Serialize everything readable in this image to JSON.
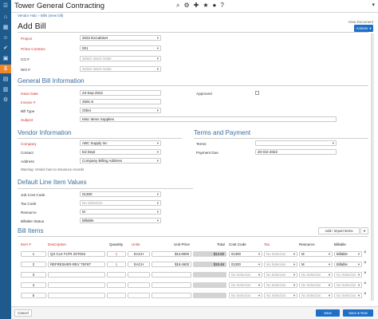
{
  "app": {
    "title": "Tower General Contracting",
    "user": "▾"
  },
  "breadcrumbs": [
    "Vendor Hub",
    "Bills (view bill)"
  ],
  "page": {
    "title": "Add Bill",
    "view_document": "View Document",
    "actions_label": "Actions"
  },
  "top_fields": [
    {
      "label": "Project",
      "value": "2022 ExCabinet",
      "required": true,
      "placeholder": false
    },
    {
      "label": "Prime Contract",
      "value": "001",
      "required": true,
      "placeholder": false
    },
    {
      "label": "CO #",
      "value": "Select Change Order",
      "required": false,
      "placeholder": true
    },
    {
      "label": "WO #",
      "value": "Select Work Order",
      "required": false,
      "placeholder": true
    }
  ],
  "general": {
    "heading": "General Bill Information",
    "issue_date_label": "Issue Date",
    "issue_date": "23-Sep-2022",
    "invoice_label": "Invoice #",
    "invoice": "4591-6",
    "bill_type_label": "Bill Type",
    "bill_type": "Other",
    "subject_label": "Subject",
    "subject": "Misc Items Supplies",
    "approved_label": "Approved"
  },
  "vendor": {
    "heading": "Vendor Information",
    "company_label": "Company",
    "company": "ABC Supply Inc",
    "contact_label": "Contact",
    "contact": "Ed Dept",
    "address_label": "Address",
    "address": "Company Billing Address",
    "warning": "Warning: Vendor has no insurance records"
  },
  "terms": {
    "heading": "Terms and Payment",
    "terms_label": "Terms",
    "terms_value": "",
    "payment_due_label": "Payment Due",
    "payment_due": "20-Oct-2022"
  },
  "defaults": {
    "heading": "Default Line Item Values",
    "job_cost_label": "Job Cost Code",
    "job_cost": "01300",
    "tax_code_label": "Tax Code",
    "tax_code": "No Selection",
    "resource_label": "Resource",
    "resource": "M",
    "billable_label": "Billable Status",
    "billable": "Billable"
  },
  "bill_items": {
    "heading": "Bill Items",
    "add_button": "Add / Import Items",
    "columns": [
      "Item #",
      "Description",
      "Quantity",
      "Units",
      "Unit Price",
      "Total",
      "Cost Code",
      "Tax",
      "Resource",
      "Billable"
    ],
    "rows": [
      {
        "item": "1",
        "description": "QX CLK FLTR 2ST0S2",
        "quantity": "1",
        "units": "EACH",
        "unit_price": "$13.8000",
        "total": "$13.80",
        "cost_code": "01300",
        "tax": "No Selection",
        "resource": "M",
        "billable": "Billable"
      },
      {
        "item": "2",
        "description": "REFRESHER-REV TSF6T",
        "quantity": "1",
        "units": "EACH",
        "unit_price": "$19.4600",
        "total": "$19.46",
        "cost_code": "01300",
        "tax": "No Selection",
        "resource": "M",
        "billable": "Billable"
      },
      {
        "item": "3",
        "description": "",
        "quantity": "",
        "units": "",
        "unit_price": "",
        "total": "",
        "cost_code": "No Selection",
        "tax": "No Selection",
        "resource": "No Selection",
        "billable": "No Selection"
      },
      {
        "item": "4",
        "description": "",
        "quantity": "",
        "units": "",
        "unit_price": "",
        "total": "",
        "cost_code": "No Selection",
        "tax": "No Selection",
        "resource": "No Selection",
        "billable": "No Selection"
      },
      {
        "item": "5",
        "description": "",
        "quantity": "",
        "units": "",
        "unit_price": "",
        "total": "",
        "cost_code": "No Selection",
        "tax": "No Selection",
        "resource": "No Selection",
        "billable": "No Selection"
      }
    ]
  },
  "footer": {
    "cancel": "Cancel",
    "save": "Save",
    "save_new": "Save & New"
  },
  "colors": {
    "sidebar": "#1e5b8c",
    "accent": "#1e6fc8",
    "required": "#c33",
    "section": "#3d6d9e",
    "active_nav": "#f0862a"
  }
}
